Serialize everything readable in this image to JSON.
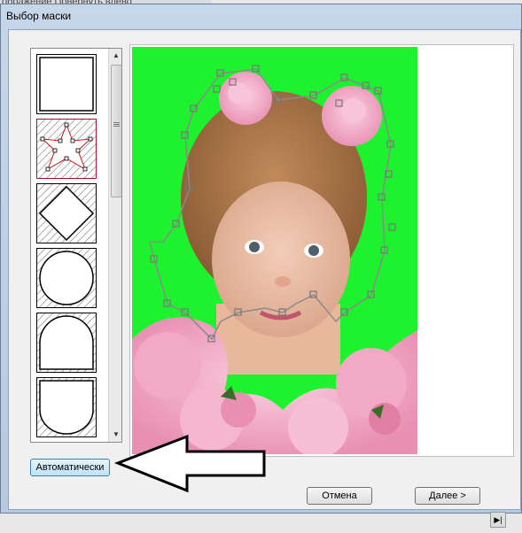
{
  "background": {
    "text": "ображение  Повернуть влево"
  },
  "dialog": {
    "title": "Выбор маски",
    "thumbnails": [
      {
        "name": "rectangle"
      },
      {
        "name": "star"
      },
      {
        "name": "diamond"
      },
      {
        "name": "circle"
      },
      {
        "name": "rounded-top"
      },
      {
        "name": "rounded-bottom"
      }
    ],
    "buttons": {
      "auto": "Автоматически",
      "cancel": "Отмена",
      "next": "Далее >"
    }
  },
  "colors": {
    "chroma_green": "#1ef22e",
    "accent_blue": "#3c7fb1",
    "star_red": "#cc1111"
  }
}
